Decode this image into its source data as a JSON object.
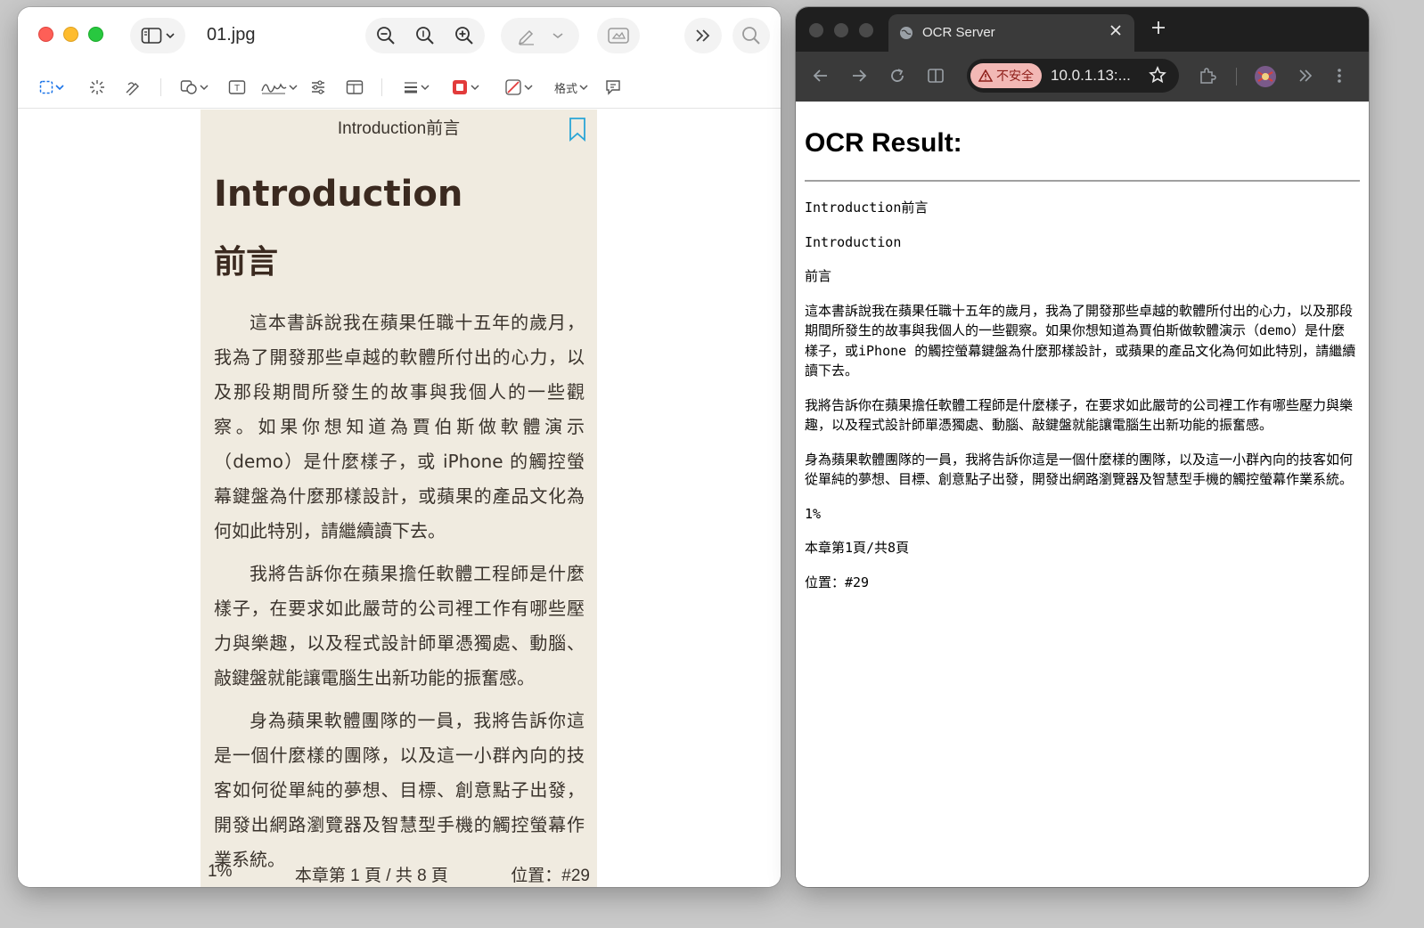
{
  "preview": {
    "file_name": "01.jpg",
    "format_label": "格式",
    "page": {
      "header": "Introduction前言",
      "title": "Introduction",
      "subtitle": "前言",
      "paragraphs": [
        "這本書訴說我在蘋果任職十五年的歲月，我為了開發那些卓越的軟體所付出的心力，以及那段期間所發生的故事與我個人的一些觀察。如果你想知道為賈伯斯做軟體演示（demo）是什麼樣子，或 iPhone 的觸控螢幕鍵盤為什麼那樣設計，或蘋果的產品文化為何如此特別，請繼續讀下去。",
        "我將告訴你在蘋果擔任軟體工程師是什麼樣子，在要求如此嚴苛的公司裡工作有哪些壓力與樂趣，以及程式設計師單憑獨處、動腦、敲鍵盤就能讓電腦生出新功能的振奮感。",
        "身為蘋果軟體團隊的一員，我將告訴你這是一個什麼樣的團隊，以及這一小群內向的技客如何從單純的夢想、目標、創意點子出發，開發出網路瀏覽器及智慧型手機的觸控螢幕作業系統。"
      ],
      "footer_progress": "1%",
      "footer_chapter": "本章第 1 頁 / 共 8 頁",
      "footer_location": "位置：#29"
    }
  },
  "chrome": {
    "tab_title": "OCR Server",
    "insecure_label": "不安全",
    "url": "10.0.1.13:...",
    "ocr": {
      "heading": "OCR Result:",
      "blocks": [
        "Introduction前言",
        "Introduction",
        "前言",
        "這本書訴說我在蘋果任職十五年的歲月，我為了開發那些卓越的軟體所付出的心力，以及那段期間所發生的故事與我個人的一些觀察。如果你想知道為賈伯斯做軟體演示（demo）是什麼樣子，或iPhone 的觸控螢幕鍵盤為什麼那樣設計，或蘋果的產品文化為何如此特別，請繼續讀下去。",
        "我將告訴你在蘋果擔任軟體工程師是什麼樣子，在要求如此嚴苛的公司裡工作有哪些壓力與樂趣，以及程式設計師單憑獨處、動腦、敲鍵盤就能讓電腦生出新功能的振奮感。",
        "身為蘋果軟體團隊的一員，我將告訴你這是一個什麼樣的團隊，以及這一小群內向的技客如何從單純的夢想、目標、創意點子出發，開發出網路瀏覽器及智慧型手機的觸控螢幕作業系統。",
        "1%",
        "本章第1頁/共8頁",
        "位置：#29"
      ]
    }
  },
  "colors": {
    "page_bg": "#f0ebe0",
    "bookmark": "#2aa5d6",
    "accent_blue": "#1a73e8",
    "insecure_bg": "#f2b8b5"
  },
  "icons": [
    "sidebar-toggle-icon",
    "zoom-out-icon",
    "zoom-fit-icon",
    "zoom-in-icon",
    "markup-pen-icon",
    "rotate-icon",
    "more-tools-icon",
    "search-icon",
    "rect-select-icon",
    "instant-alpha-icon",
    "sketch-icon",
    "shapes-icon",
    "text-box-icon",
    "signature-icon",
    "adjust-color-icon",
    "page-layout-icon",
    "line-style-icon",
    "border-color-icon",
    "fill-color-icon",
    "note-icon",
    "bookmark-icon",
    "back-icon",
    "forward-icon",
    "reload-icon",
    "split-view-icon",
    "warning-icon",
    "star-icon",
    "extensions-icon",
    "profile-avatar",
    "menu-icon"
  ]
}
